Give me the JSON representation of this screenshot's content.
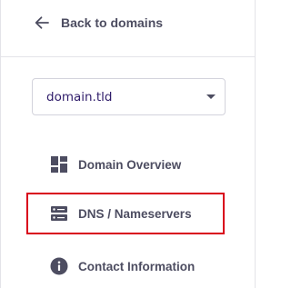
{
  "back": {
    "label": "Back to domains",
    "icon": "arrow-left-icon"
  },
  "domain_select": {
    "value": "domain.tld",
    "icon": "caret-down-icon"
  },
  "menu": {
    "items": [
      {
        "label": "Domain Overview",
        "icon": "dashboard-grid-icon"
      },
      {
        "label": "DNS / Nameservers",
        "icon": "server-icon",
        "highlighted": true
      },
      {
        "label": "Contact Information",
        "icon": "info-circle-icon"
      }
    ]
  },
  "colors": {
    "text": "#4d4d61",
    "highlight_border": "#d9001b",
    "select_text": "#2f1c6a"
  }
}
